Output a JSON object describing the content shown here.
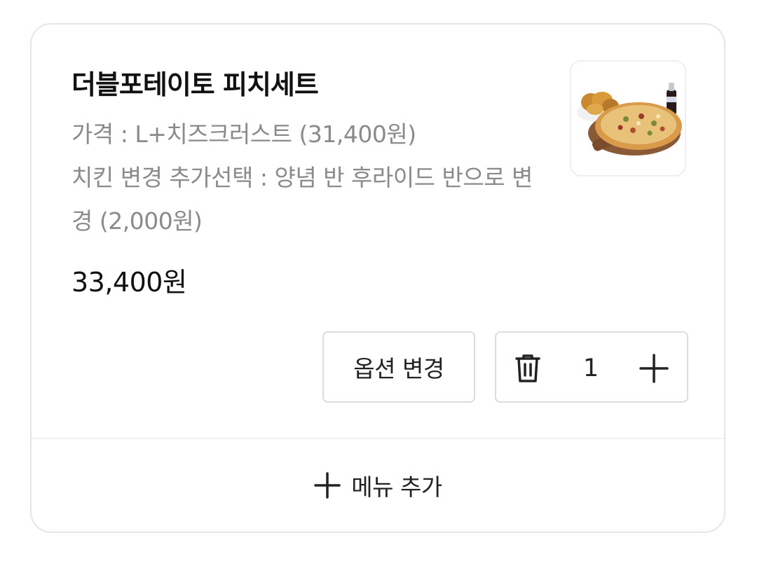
{
  "item": {
    "name": "더블포테이토 피치세트",
    "options": [
      "가격 : L+치즈크러스트 (31,400원)",
      "치킨 변경 추가선택 : 양념 반 후라이드 반으로 변경 (2,000원)"
    ],
    "price": "33,400원",
    "image_icon": "pizza-chicken-set-photo",
    "quantity": "1"
  },
  "actions": {
    "change_option_label": "옵션 변경",
    "add_menu_label": "메뉴 추가"
  },
  "icons": {
    "delete": "trash-icon",
    "increase": "plus-icon",
    "add_menu": "plus-icon"
  },
  "colors": {
    "border": "#e6e6e6",
    "option_text": "#8a8a8a",
    "primary_text": "#111111"
  }
}
